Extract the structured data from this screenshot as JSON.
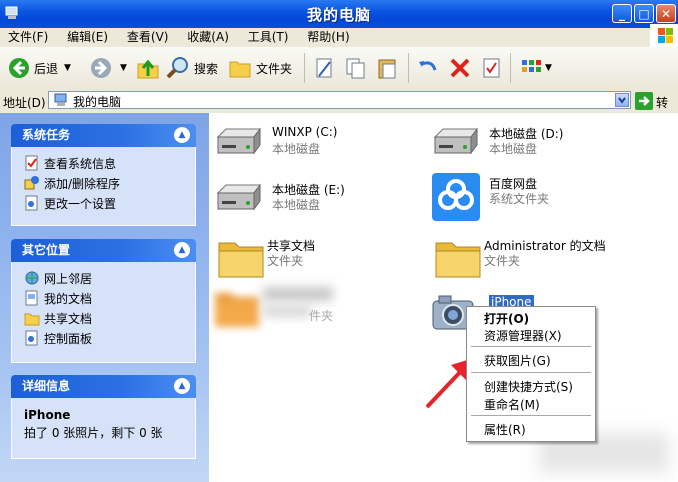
{
  "window": {
    "title": "我的电脑",
    "buttons": [
      "_",
      "□",
      "✕"
    ]
  },
  "menu": [
    "文件(F)",
    "编辑(E)",
    "查看(V)",
    "收藏(A)",
    "工具(T)",
    "帮助(H)"
  ],
  "toolbar": {
    "back": "后退",
    "search": "搜索",
    "folders": "文件夹"
  },
  "address": {
    "label": "地址(D)",
    "value": "我的电脑",
    "go": "转到"
  },
  "sidebar": {
    "system_tasks": {
      "title": "系统任务",
      "items": [
        "查看系统信息",
        "添加/删除程序",
        "更改一个设置"
      ]
    },
    "other_places": {
      "title": "其它位置",
      "items": [
        "网上邻居",
        "我的文档",
        "共享文档",
        "控制面板"
      ]
    },
    "details": {
      "title": "详细信息",
      "name": "iPhone",
      "text": "拍了 0 张照片，剩下 0 张"
    }
  },
  "items": [
    {
      "name": "WINXP (C:)",
      "type": "本地磁盘",
      "icon": "hard-drive-icon"
    },
    {
      "name": "本地磁盘 (D:)",
      "type": "本地磁盘",
      "icon": "hard-drive-icon"
    },
    {
      "name": "本地磁盘 (E:)",
      "type": "本地磁盘",
      "icon": "hard-drive-icon"
    },
    {
      "name": "百度网盘",
      "type": "系统文件夹",
      "icon": "baidu-netdisk-icon"
    },
    {
      "name": "共享文档",
      "type": "文件夹",
      "icon": "folder-icon"
    },
    {
      "name": "Administrator 的文档",
      "type": "文件夹",
      "icon": "folder-icon"
    },
    {
      "name": "",
      "type": "件夹",
      "icon": "folder-icon"
    },
    {
      "name": "iPhone",
      "type": "",
      "icon": "camera-icon"
    }
  ],
  "context_menu": {
    "items": [
      "打开(O)",
      "资源管理器(X)",
      "获取图片(G)",
      "创建快捷方式(S)",
      "重命名(M)",
      "属性(R)"
    ]
  },
  "colors": {
    "title_bar": "#0a55e3",
    "sidebar_header": "#2c71e4",
    "annotation_arrow": "#e5242b"
  }
}
